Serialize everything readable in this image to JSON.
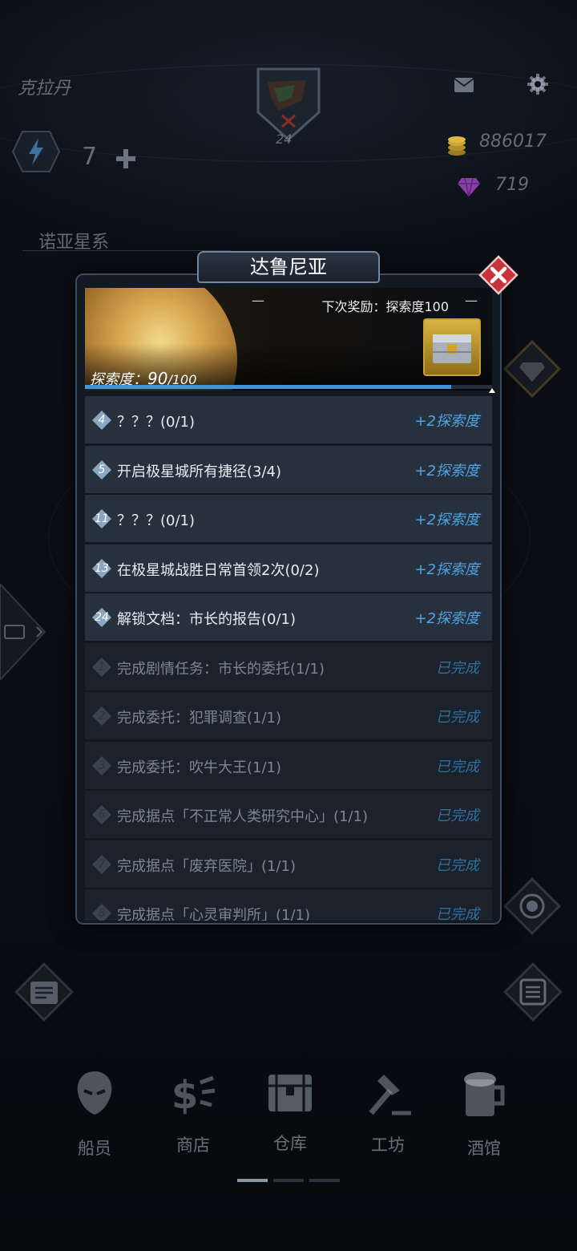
{
  "header": {
    "location": "克拉丹",
    "emblem_level": "24",
    "energy": "7",
    "coins": "886017",
    "gems": "719",
    "system": "诺亚星系"
  },
  "modal": {
    "title": "达鲁尼亚",
    "next_reward_label": "下次奖励：探索度100",
    "explore_label": "探索度：",
    "explore_value": "90",
    "explore_max": "/100",
    "explore_progress": 0.9,
    "tasks": [
      {
        "num": "4",
        "text": "？？？(0/1)",
        "reward": "+2探索度",
        "status": "pending"
      },
      {
        "num": "5",
        "text": "开启极星城所有捷径(3/4)",
        "reward": "+2探索度",
        "status": "pending"
      },
      {
        "num": "11",
        "text": "？？？(0/1)",
        "reward": "+2探索度",
        "status": "pending"
      },
      {
        "num": "13",
        "text": "在极星城战胜日常首领2次(0/2)",
        "reward": "+2探索度",
        "status": "pending"
      },
      {
        "num": "24",
        "text": "解锁文档：市长的报告(0/1)",
        "reward": "+2探索度",
        "status": "pending"
      },
      {
        "num": "1",
        "text": "完成剧情任务：市长的委托(1/1)",
        "reward": "已完成",
        "status": "done"
      },
      {
        "num": "2",
        "text": "完成委托：犯罪调查(1/1)",
        "reward": "已完成",
        "status": "done"
      },
      {
        "num": "3",
        "text": "完成委托：吹牛大王(1/1)",
        "reward": "已完成",
        "status": "done"
      },
      {
        "num": "6",
        "text": "完成据点「不正常人类研究中心」(1/1)",
        "reward": "已完成",
        "status": "done"
      },
      {
        "num": "7",
        "text": "完成据点「废弃医院」(1/1)",
        "reward": "已完成",
        "status": "done"
      },
      {
        "num": "8",
        "text": "完成据点「心灵审判所」(1/1)",
        "reward": "已完成",
        "status": "done"
      }
    ]
  },
  "nav": {
    "items": [
      {
        "label": "船员",
        "icon": "crew-icon"
      },
      {
        "label": "商店",
        "icon": "shop-icon"
      },
      {
        "label": "仓库",
        "icon": "warehouse-icon"
      },
      {
        "label": "工坊",
        "icon": "workshop-icon"
      },
      {
        "label": "酒馆",
        "icon": "tavern-icon"
      }
    ],
    "active_page": 1
  },
  "colors": {
    "accent_blue": "#4da3e4",
    "close_red": "#d0343b",
    "gold": "#c9a037"
  }
}
